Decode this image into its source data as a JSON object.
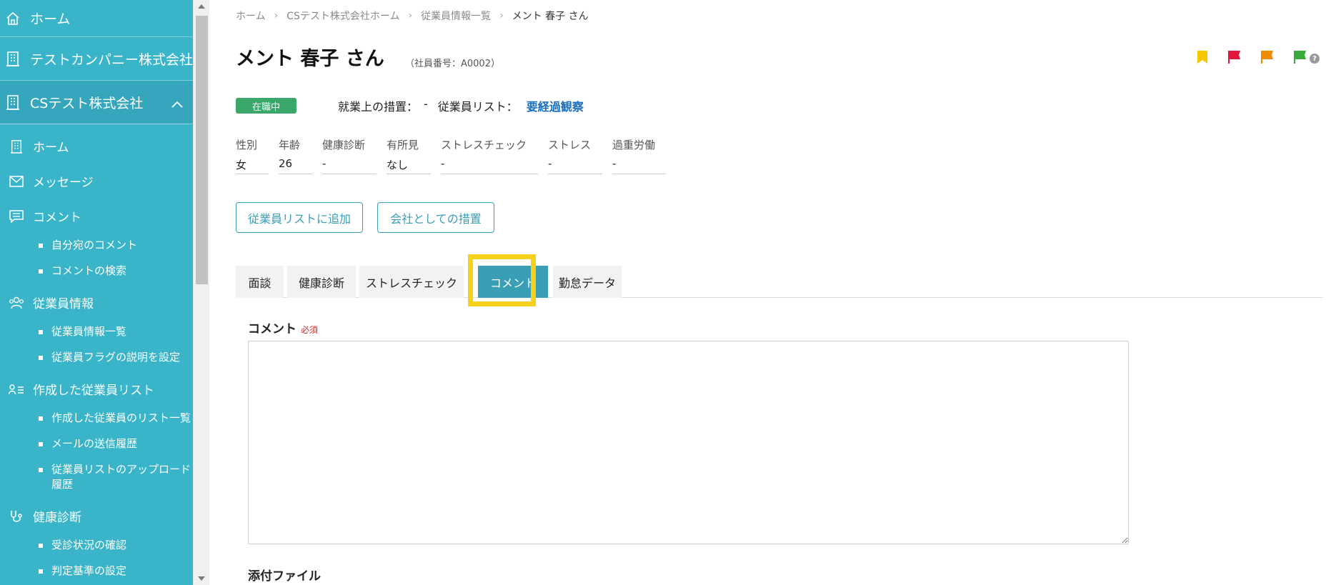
{
  "sidebar": {
    "home_top": "ホーム",
    "company1": "テストカンパニー株式会社",
    "company2": "CSテスト株式会社",
    "items": {
      "home": "ホーム",
      "message": "メッセージ",
      "comment": "コメント",
      "comment_sub": [
        "自分宛のコメント",
        "コメントの検索"
      ],
      "employee": "従業員情報",
      "employee_sub": [
        "従業員情報一覧",
        "従業員フラグの説明を設定"
      ],
      "list": "作成した従業員リスト",
      "list_sub": [
        "作成した従業員のリスト一覧",
        "メールの送信履歴",
        "従業員リストのアップロード履歴"
      ],
      "health": "健康診断",
      "health_sub": [
        "受診状況の確認",
        "判定基準の設定"
      ]
    }
  },
  "breadcrumb": [
    "ホーム",
    "CSテスト株式会社ホーム",
    "従業員情報一覧",
    "メント 春子 さん"
  ],
  "page": {
    "title": "メント 春子 さん",
    "employee_no": "（社員番号：A0002）",
    "status": "在職中",
    "measures_label": "就業上の措置：",
    "measures_value": "-",
    "list_label": "従業員リスト：",
    "list_value": "要経過観察"
  },
  "attributes": [
    {
      "label": "性別",
      "value": "女"
    },
    {
      "label": "年齢",
      "value": "26"
    },
    {
      "label": "健康診断",
      "value": "-"
    },
    {
      "label": "有所見",
      "value": "なし"
    },
    {
      "label": "ストレスチェック",
      "value": "-"
    },
    {
      "label": "ストレス",
      "value": "-"
    },
    {
      "label": "過重労働",
      "value": "-"
    }
  ],
  "buttons": {
    "add_to_list": "従業員リストに追加",
    "company_measures": "会社としての措置"
  },
  "tabs": [
    "面談",
    "健康診断",
    "ストレスチェック",
    "コメント",
    "勤怠データ"
  ],
  "active_tab": "コメント",
  "form": {
    "comment_label": "コメント",
    "required": "必須",
    "comment_value": "",
    "attachment_label": "添付ファイル"
  },
  "flags": {
    "colors": [
      "#f5c800",
      "#e0163b",
      "#f08a00",
      "#3aa83a"
    ],
    "help": "?"
  }
}
